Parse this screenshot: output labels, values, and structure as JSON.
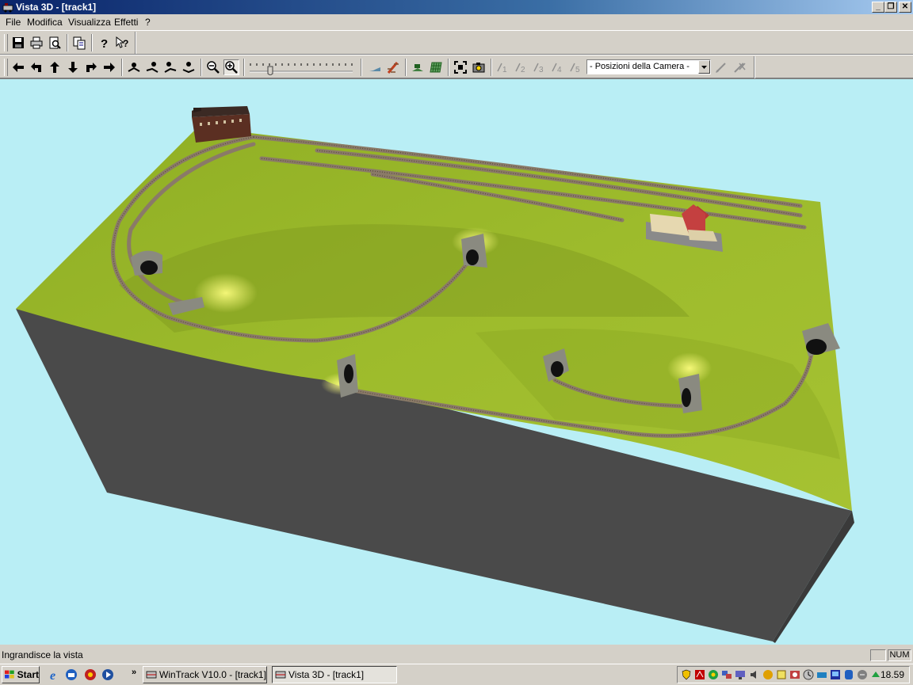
{
  "window": {
    "title": "Vista 3D - [track1]",
    "controls": {
      "minimize": "_",
      "restore": "❐",
      "close": "✕"
    }
  },
  "menu": {
    "items": [
      "File",
      "Modifica",
      "Visualizza",
      "Effetti",
      "?"
    ]
  },
  "toolbar1": {
    "icons": [
      "save-icon",
      "print-icon",
      "print-preview-icon",
      "copy-icon",
      "help-icon",
      "context-help-icon"
    ]
  },
  "toolbar2": {
    "icons": [
      "arrow-left-icon",
      "turn-left-icon",
      "arrow-up-icon",
      "arrow-down-icon",
      "turn-right-icon",
      "arrow-right-icon",
      "tilt-icon",
      "tilt-icon",
      "tilt-icon",
      "tilt-icon",
      "zoom-out-icon",
      "zoom-in-icon",
      "terrain-icon",
      "track-icon",
      "scenery-icon",
      "grid-icon",
      "fit-view-icon",
      "camera-icon",
      "camera-position-1-icon",
      "camera-position-2-icon",
      "camera-position-3-icon",
      "camera-position-4-icon",
      "camera-position-5-icon",
      "edit-camera-icon",
      "delete-camera-icon"
    ],
    "camera_positions_label": "- Posizioni della Camera -",
    "slider_value": 0.2
  },
  "status": {
    "text": "Ingrandisce la vista",
    "num": "NUM"
  },
  "taskbar": {
    "start": "Start",
    "chevron": "»",
    "tasks": [
      "WinTrack  V10.0 - [track1]",
      "Vista 3D - [track1]"
    ],
    "active_task": "Vista 3D - [track1]",
    "clock": "18.59"
  },
  "colors": {
    "viewport_bg": "#b9eef5",
    "terrain": "#9ab828",
    "base": "#4a4a4a",
    "rail": "#8a7a68",
    "title_gradient_start": "#0a246a"
  }
}
